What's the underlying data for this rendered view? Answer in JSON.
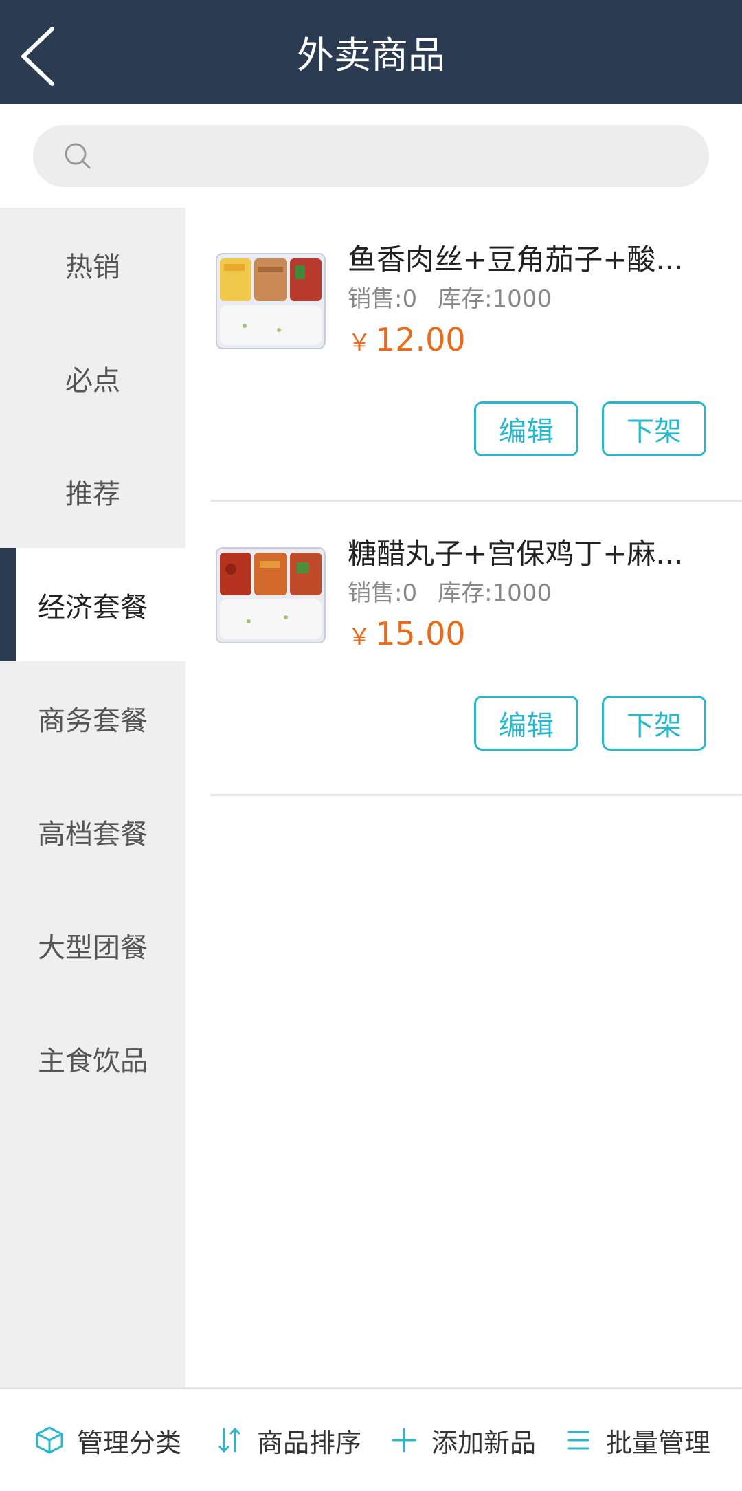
{
  "header": {
    "title": "外卖商品",
    "back_icon": "back-arrow-icon"
  },
  "search": {
    "placeholder": "",
    "value": ""
  },
  "sidebar": {
    "active_index": 3,
    "items": [
      {
        "label": "热销"
      },
      {
        "label": "必点"
      },
      {
        "label": "推荐"
      },
      {
        "label": "经济套餐"
      },
      {
        "label": "商务套餐"
      },
      {
        "label": "高档套餐"
      },
      {
        "label": "大型团餐"
      },
      {
        "label": "主食饮品"
      }
    ]
  },
  "products": [
    {
      "name": "鱼香肉丝+豆角茄子+酸...",
      "sales": "销售:0",
      "stock": "库存:1000",
      "currency": "￥",
      "price": "12.00",
      "edit_label": "编辑",
      "off_label": "下架"
    },
    {
      "name": "糖醋丸子+宫保鸡丁+麻...",
      "sales": "销售:0",
      "stock": "库存:1000",
      "currency": "￥",
      "price": "15.00",
      "edit_label": "编辑",
      "off_label": "下架"
    }
  ],
  "bottom_bar": {
    "items": [
      {
        "label": "管理分类",
        "icon": "cube-icon"
      },
      {
        "label": "商品排序",
        "icon": "sort-icon"
      },
      {
        "label": "添加新品",
        "icon": "plus-icon"
      },
      {
        "label": "批量管理",
        "icon": "list-icon"
      }
    ]
  },
  "colors": {
    "header_bg": "#2b3c52",
    "accent": "#28b7cc",
    "price": "#e86a1a",
    "sidebar_bg": "#efefef"
  }
}
